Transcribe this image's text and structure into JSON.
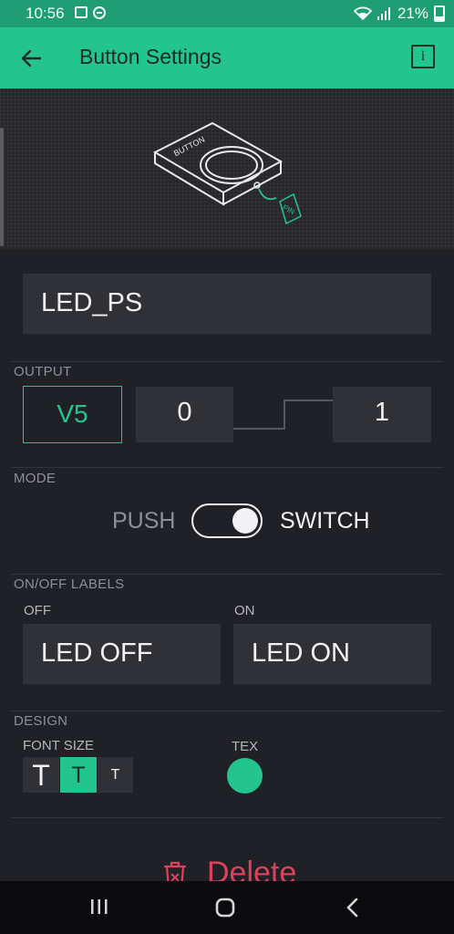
{
  "status_bar": {
    "time": "10:56",
    "battery": "21%",
    "icons": [
      "image-notification-icon",
      "do-not-disturb-icon",
      "wifi-icon",
      "signal-icon",
      "battery-icon"
    ]
  },
  "app_bar": {
    "title": "Button Settings",
    "back_icon": "arrow-left-icon",
    "info_label": "i"
  },
  "hero": {
    "device_label": "BUTTON",
    "pin_label": "PIN"
  },
  "name_field": {
    "value": "LED_PS"
  },
  "output": {
    "label": "OUTPUT",
    "pin": "V5",
    "min": "0",
    "max": "1"
  },
  "mode": {
    "label": "MODE",
    "left_option": "PUSH",
    "right_option": "SWITCH",
    "selected": "SWITCH"
  },
  "onoff_labels": {
    "label": "ON/OFF LABELS",
    "off_label": "OFF",
    "off_value": "LED OFF",
    "on_label": "ON",
    "on_value": "LED ON"
  },
  "design": {
    "label": "DESIGN",
    "font_size_label": "FONT SIZE",
    "font_sizes": [
      "T",
      "T",
      "T"
    ],
    "selected_font_size": 1,
    "text_color_label": "TEX",
    "text_color": "#23c48e"
  },
  "delete": {
    "label": "Delete",
    "icon": "trash-icon"
  },
  "nav_bar": {
    "icons": [
      "recents-icon",
      "home-icon",
      "back-icon"
    ]
  },
  "colors": {
    "accent": "#23c48e",
    "status_bar": "#1f9e75",
    "background": "#202126",
    "field": "#303136",
    "danger": "#d9435c"
  }
}
